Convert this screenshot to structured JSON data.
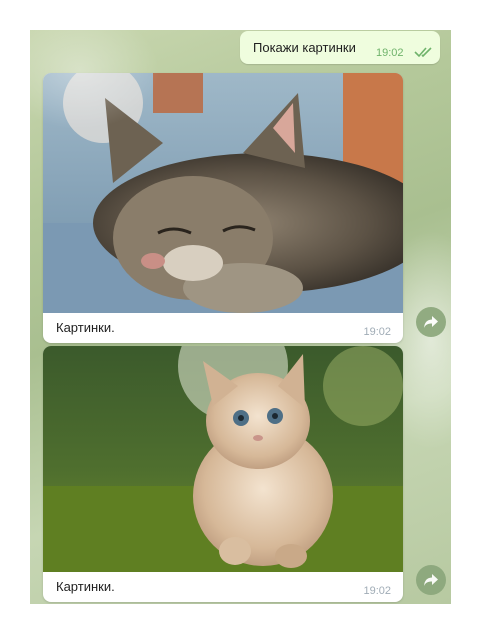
{
  "outgoing": {
    "text": "Покажи картинки",
    "time": "19:02"
  },
  "messages": [
    {
      "caption": "Картинки.",
      "time": "19:02",
      "photo_icon": "sleeping-cat-photo"
    },
    {
      "caption": "Картинки.",
      "time": "19:02",
      "photo_icon": "kitten-photo"
    }
  ],
  "icons": {
    "read_status": "double-check-icon",
    "share": "share-arrow-icon"
  },
  "colors": {
    "outgoing_bubble": "#effdde",
    "time_outgoing": "#6fb36b",
    "share_button": "#8aa67a"
  }
}
